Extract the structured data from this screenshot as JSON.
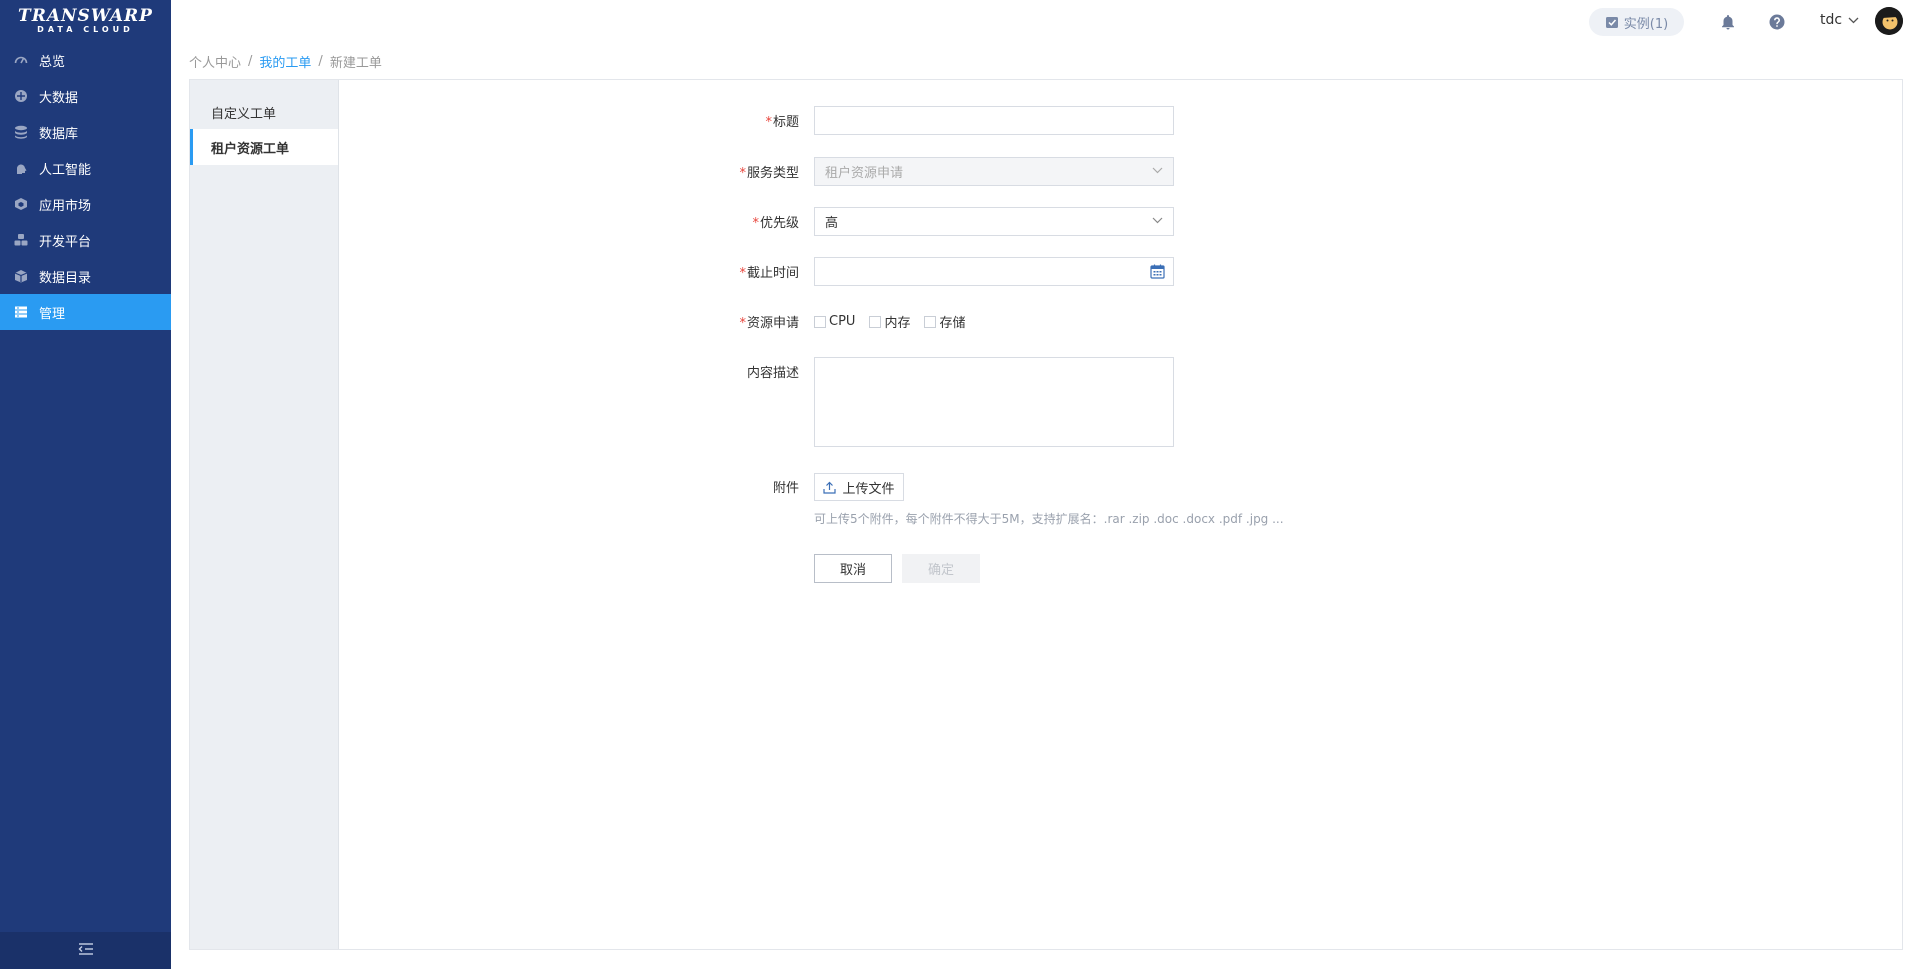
{
  "brand": {
    "name": "TRANSWARP",
    "tagline": "DATA CLOUD"
  },
  "sidebar": {
    "items": [
      {
        "label": "总览",
        "icon": "dashboard-gauge-icon",
        "active": false
      },
      {
        "label": "大数据",
        "icon": "big-data-icon",
        "active": false
      },
      {
        "label": "数据库",
        "icon": "database-icon",
        "active": false
      },
      {
        "label": "人工智能",
        "icon": "ai-brain-icon",
        "active": false
      },
      {
        "label": "应用市场",
        "icon": "app-market-icon",
        "active": false
      },
      {
        "label": "开发平台",
        "icon": "dev-platform-icon",
        "active": false
      },
      {
        "label": "数据目录",
        "icon": "data-catalog-icon",
        "active": false
      },
      {
        "label": "管理",
        "icon": "management-icon",
        "active": true
      }
    ],
    "collapse_icon": "collapse-menu-icon"
  },
  "header": {
    "instances_label": "实例(1)",
    "username": "tdc"
  },
  "breadcrumb": {
    "items": [
      "个人中心",
      "我的工单",
      "新建工单"
    ],
    "separator": "/"
  },
  "subnav": {
    "items": [
      {
        "label": "自定义工单",
        "active": false
      },
      {
        "label": "租户资源工单",
        "active": true
      }
    ]
  },
  "form": {
    "required_mark": "*",
    "title": {
      "label": "标题",
      "value": ""
    },
    "service_type": {
      "label": "服务类型",
      "value": "租户资源申请"
    },
    "priority": {
      "label": "优先级",
      "value": "高"
    },
    "deadline": {
      "label": "截止时间",
      "value": ""
    },
    "resource": {
      "label": "资源申请",
      "options": [
        {
          "label": "CPU",
          "checked": false
        },
        {
          "label": "内存",
          "checked": false
        },
        {
          "label": "存储",
          "checked": false
        }
      ]
    },
    "description": {
      "label": "内容描述",
      "value": ""
    },
    "attachment": {
      "label": "附件",
      "upload_label": "上传文件",
      "hint": "可上传5个附件，每个附件不得大于5M，支持扩展名：.rar .zip .doc .docx .pdf .jpg ..."
    },
    "cancel_label": "取消",
    "confirm_label": "确定"
  },
  "colors": {
    "sidebar_bg": "#1f3a7a",
    "accent": "#2a9bf2",
    "required": "#e8453c"
  }
}
